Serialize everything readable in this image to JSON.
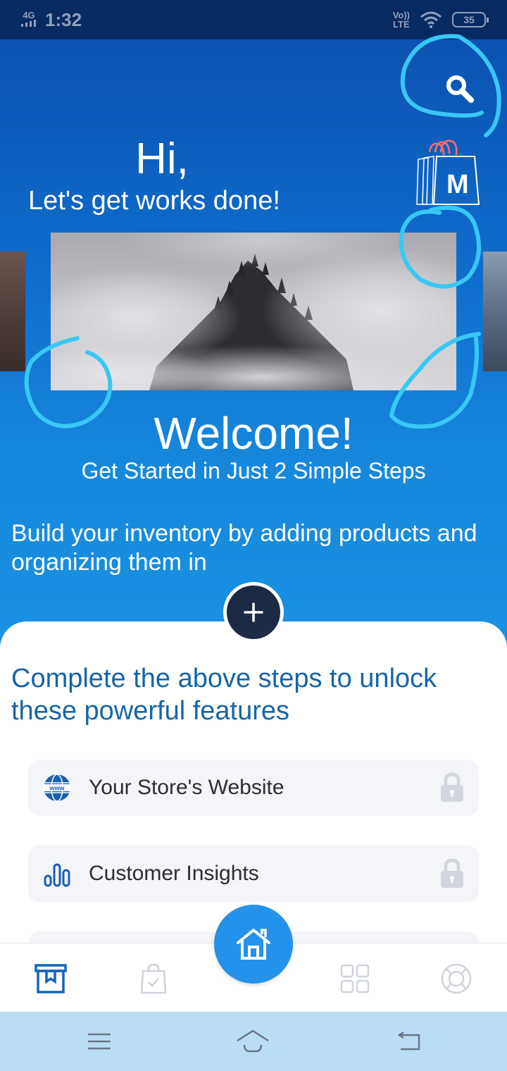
{
  "status_bar": {
    "network": "4G",
    "time": "1:32",
    "volte_top": "Vo))",
    "volte_bottom": "LTE",
    "battery": "35",
    "icons": [
      "signal-icon",
      "wifi-icon",
      "battery-icon"
    ]
  },
  "header": {
    "greeting": "Hi,",
    "subtitle": "Let's get works done!",
    "store_badge_letter": "M",
    "icons": [
      "search-icon",
      "shopping-bag-icon"
    ]
  },
  "welcome": {
    "title": "Welcome!",
    "subtitle": "Get Started in Just 2 Simple Steps",
    "body": "Build your inventory by adding products and organizing them in"
  },
  "card": {
    "title": "Complete the above steps to unlock these powerful features",
    "features": [
      {
        "label": "Your Store's Website",
        "icon": "www-globe-icon",
        "locked": true
      },
      {
        "label": "Customer Insights",
        "icon": "bar-chart-icon",
        "locked": true
      }
    ]
  },
  "bottom_nav": {
    "items": [
      "store-icon",
      "orders-bag-icon",
      "home-icon",
      "grid-icon",
      "support-lifebuoy-icon"
    ],
    "active": "store-icon"
  },
  "system_nav": {
    "items": [
      "menu-icon",
      "home-outline-icon",
      "back-icon"
    ]
  },
  "colors": {
    "hero_top": "#0c52b0",
    "hero_bottom": "#1a92e2",
    "card_title": "#1665a8",
    "fab": "#2492ea",
    "add_button": "#1d2a44",
    "annotation": "#38c8f6"
  }
}
